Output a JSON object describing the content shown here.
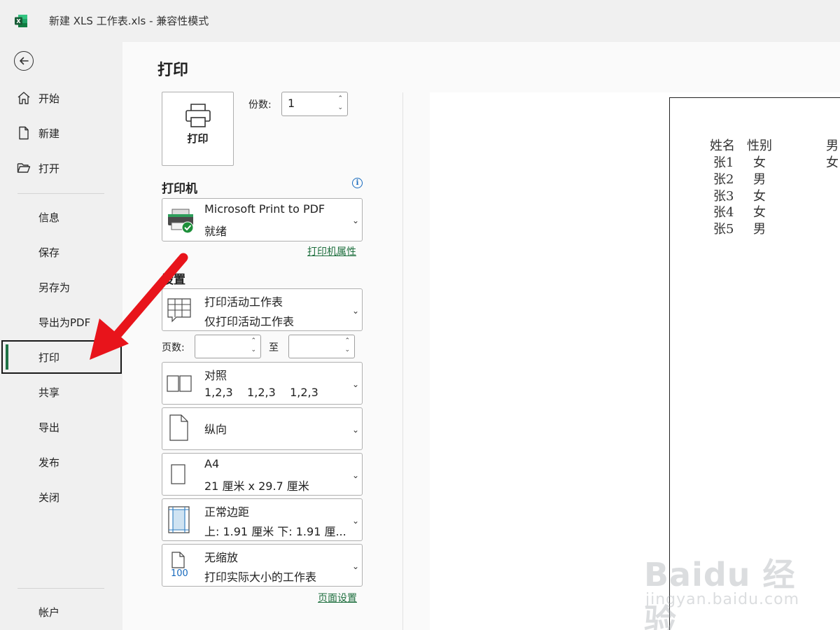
{
  "app": {
    "title": "新建 XLS 工作表.xls  -  兼容性模式"
  },
  "nav": {
    "top_items": [
      {
        "label": "开始",
        "icon": "home-icon"
      },
      {
        "label": "新建",
        "icon": "new-file-icon"
      },
      {
        "label": "打开",
        "icon": "open-folder-icon"
      }
    ],
    "items": [
      {
        "label": "信息"
      },
      {
        "label": "保存"
      },
      {
        "label": "另存为"
      },
      {
        "label": "导出为PDF"
      },
      {
        "label": "打印",
        "active": true
      },
      {
        "label": "共享"
      },
      {
        "label": "导出"
      },
      {
        "label": "发布"
      },
      {
        "label": "关闭"
      }
    ],
    "account": "帐户"
  },
  "print": {
    "title": "打印",
    "button_label": "打印",
    "copies_label": "份数:",
    "copies_value": "1",
    "printer_heading": "打印机",
    "printer_name": "Microsoft Print to PDF",
    "printer_status": "就绪",
    "printer_properties": "打印机属性",
    "settings_heading": "设置",
    "what_to_print": {
      "title": "打印活动工作表",
      "subtitle": "仅打印活动工作表"
    },
    "pages_label": "页数:",
    "pages_to_label": "至",
    "pages_from": "",
    "pages_to": "",
    "collate": {
      "title": "对照",
      "subtitle": "1,2,3    1,2,3    1,2,3"
    },
    "orientation": {
      "title": "纵向"
    },
    "paper": {
      "title": "A4",
      "subtitle": "21 厘米 x 29.7 厘米"
    },
    "margins": {
      "title": "正常边距",
      "subtitle": "上: 1.91 厘米 下: 1.91 厘..."
    },
    "scaling": {
      "title": "无缩放",
      "subtitle": "打印实际大小的工作表",
      "icon_text": "100"
    },
    "page_setup": "页面设置"
  },
  "preview": {
    "header": [
      "姓名",
      "性别"
    ],
    "rows": [
      [
        "张1",
        "女"
      ],
      [
        "张2",
        "男"
      ],
      [
        "张3",
        "女"
      ],
      [
        "张4",
        "女"
      ],
      [
        "张5",
        "男"
      ]
    ],
    "side_col": [
      "男",
      "女"
    ]
  },
  "watermark": {
    "brand": "Baidu 经验",
    "url": "jingyan.baidu.com"
  },
  "colors": {
    "excel_green": "#1e7145",
    "annotation_red": "#e8141b",
    "link_green": "#1e6f3e"
  }
}
